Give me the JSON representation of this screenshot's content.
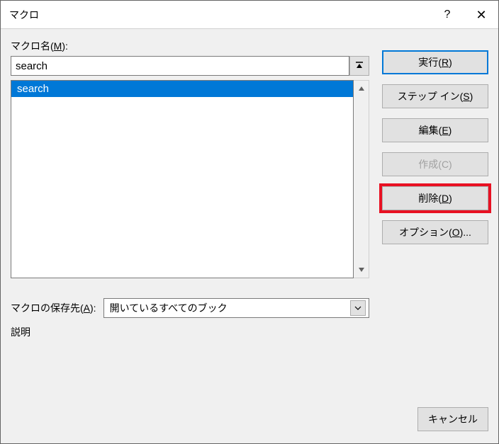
{
  "window": {
    "title": "マクロ",
    "help": "?",
    "close": "✕"
  },
  "labels": {
    "macro_name": "マクロ名(<u>M</u>):",
    "storage": "マクロの保存先(<u>A</u>):",
    "description": "説明"
  },
  "macro_name_value": "search",
  "macro_list": [
    {
      "label": "search",
      "selected": true
    }
  ],
  "storage_value": "開いているすべてのブック",
  "buttons": {
    "run": {
      "label": "実行(<u>R</u>)"
    },
    "stepin": {
      "label": "ステップ イン(<u>S</u>)"
    },
    "edit": {
      "label": "編集(<u>E</u>)"
    },
    "create": {
      "label": "作成(C)"
    },
    "delete": {
      "label": "削除(<u>D</u>)"
    },
    "options": {
      "label": "オプション(<u>O</u>)..."
    },
    "cancel": {
      "label": "キャンセル"
    }
  }
}
